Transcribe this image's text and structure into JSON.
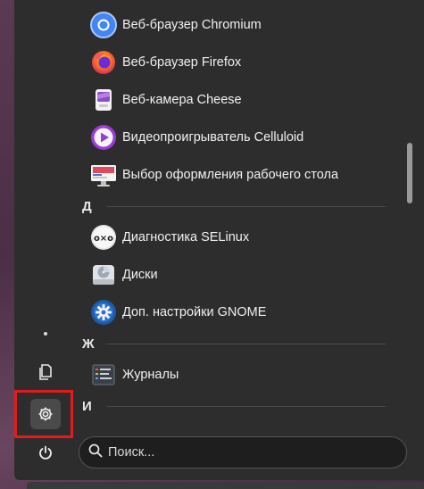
{
  "apps": [
    {
      "label": "Веб-браузер Chromium",
      "icon": "chromium-icon"
    },
    {
      "label": "Веб-браузер Firefox",
      "icon": "firefox-icon"
    },
    {
      "label": "Веб-камера Cheese",
      "icon": "cheese-icon"
    },
    {
      "label": "Видеопроигрыватель Celluloid",
      "icon": "celluloid-icon"
    },
    {
      "label": "Выбор оформления рабочего стола",
      "icon": "desktop-theme-icon"
    },
    {
      "label": "Диагностика SELinux",
      "icon": "selinux-icon"
    },
    {
      "label": "Диски",
      "icon": "disks-icon"
    },
    {
      "label": "Доп. настройки GNOME",
      "icon": "gnome-tweaks-icon"
    },
    {
      "label": "Журналы",
      "icon": "logs-icon"
    }
  ],
  "sections": {
    "d": "Д",
    "zh": "Ж",
    "i": "И"
  },
  "sidebar": {
    "items": [
      {
        "name": "home-dot-icon"
      },
      {
        "name": "documents-icon"
      },
      {
        "name": "settings-icon",
        "active": true
      },
      {
        "name": "power-icon"
      }
    ]
  },
  "search": {
    "placeholder": "Поиск..."
  },
  "colors": {
    "menu_bg": "#2d2d2d",
    "highlight": "#e31b1b"
  }
}
